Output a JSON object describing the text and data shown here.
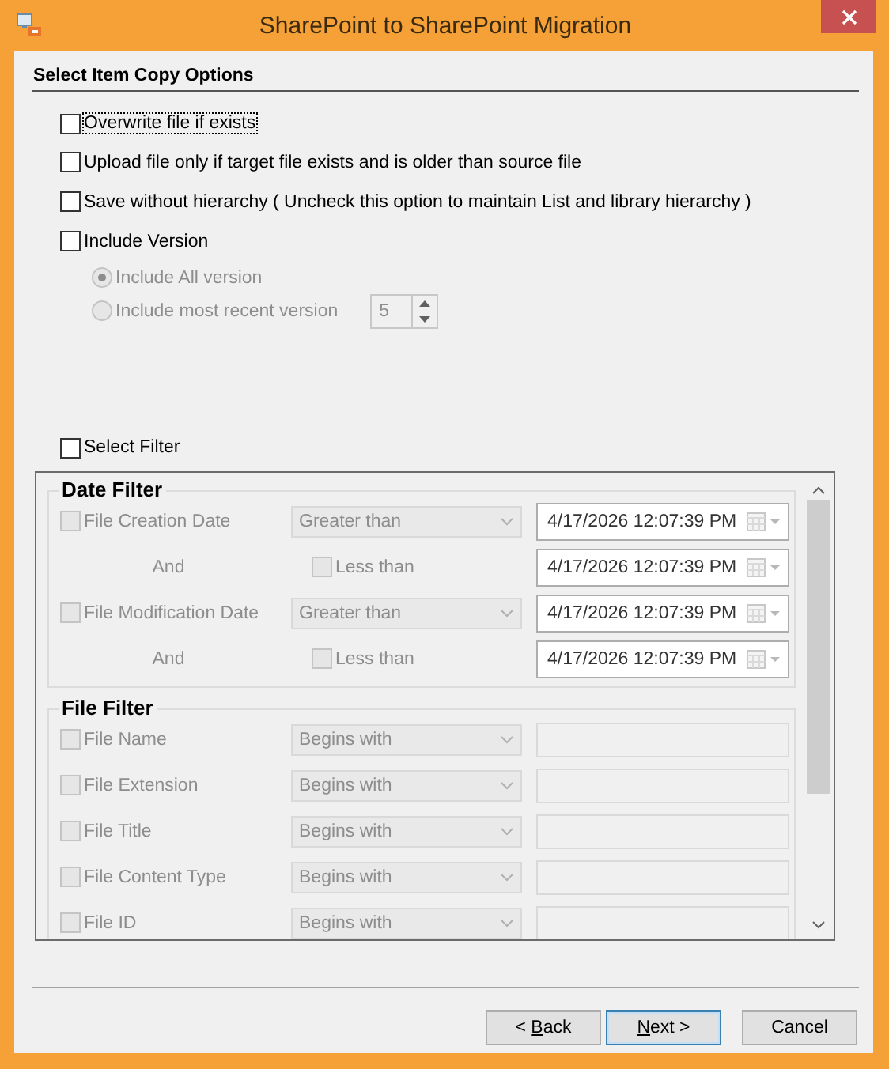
{
  "window": {
    "title": "SharePoint to SharePoint Migration"
  },
  "section_title": "Select Item Copy Options",
  "options": [
    {
      "label": "Overwrite file if exists",
      "checked": false,
      "focused": true
    },
    {
      "label": "Upload file only if target file exists and is older than source file",
      "checked": false,
      "focused": false
    },
    {
      "label": "Save without hierarchy ( Uncheck this option to maintain List and library hierarchy )",
      "checked": false,
      "focused": false
    },
    {
      "label": "Include Version",
      "checked": false,
      "focused": false
    }
  ],
  "version_options": {
    "disabled": true,
    "radios": [
      {
        "label": "Include All version",
        "selected": true
      },
      {
        "label": "Include most recent version",
        "selected": false
      }
    ],
    "spinner": {
      "value": "5"
    }
  },
  "select_filter": {
    "label": "Select Filter",
    "checked": false
  },
  "filter_panel": {
    "disabled": true,
    "date_filter": {
      "title": "Date Filter",
      "rows": [
        {
          "kind": "field",
          "label": "File Creation Date",
          "checked": false,
          "operator": "Greater than",
          "date": "4/17/2026 12:07:39 PM"
        },
        {
          "kind": "and",
          "label": "And",
          "check_label": "Less than",
          "checked": false,
          "date": "4/17/2026 12:07:39 PM"
        },
        {
          "kind": "field",
          "label": "File Modification Date",
          "checked": false,
          "operator": "Greater than",
          "date": "4/17/2026 12:07:39 PM"
        },
        {
          "kind": "and",
          "label": "And",
          "check_label": "Less than",
          "checked": false,
          "date": "4/17/2026 12:07:39 PM"
        }
      ]
    },
    "file_filter": {
      "title": "File Filter",
      "rows": [
        {
          "label": "File Name",
          "checked": false,
          "operator": "Begins with"
        },
        {
          "label": "File Extension",
          "checked": false,
          "operator": "Begins with"
        },
        {
          "label": "File Title",
          "checked": false,
          "operator": "Begins with"
        },
        {
          "label": "File Content Type",
          "checked": false,
          "operator": "Begins with"
        },
        {
          "label": "File ID",
          "checked": false,
          "operator": "Begins with"
        }
      ]
    }
  },
  "buttons": [
    {
      "label_before": "< ",
      "access_key": "B",
      "label_after": "ack",
      "default": false
    },
    {
      "access_key": "N",
      "label_after": "ext >",
      "default": true
    },
    {
      "label_before": "Cancel",
      "default": false
    }
  ]
}
